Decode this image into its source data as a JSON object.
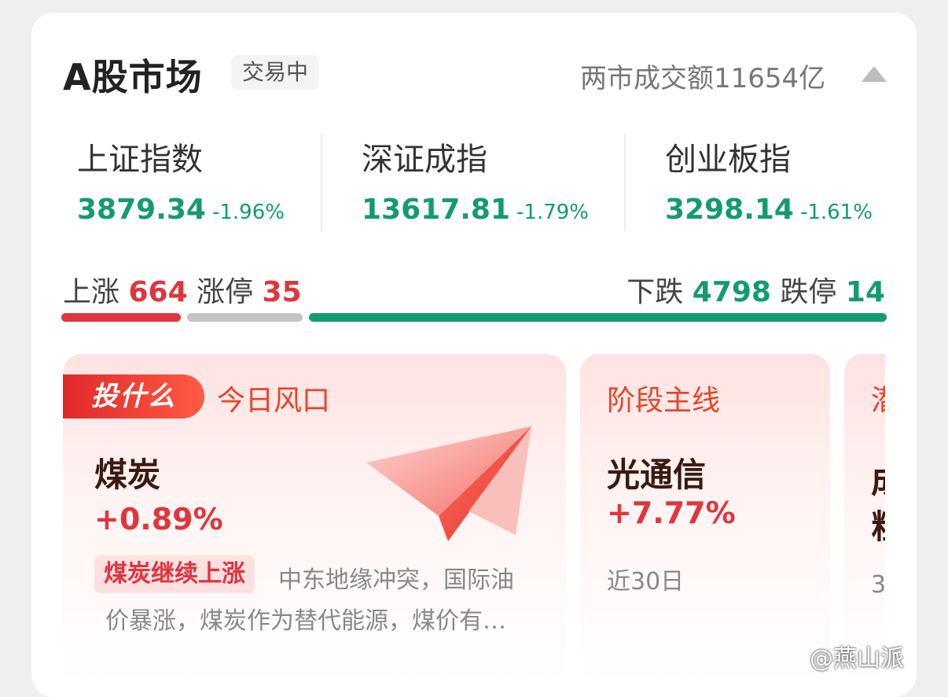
{
  "header": {
    "title": "A股市场",
    "status": "交易中",
    "turnover": "两市成交额11654亿"
  },
  "indices": [
    {
      "name": "上证指数",
      "value": "3879.34",
      "change": "-1.96%"
    },
    {
      "name": "深证成指",
      "value": "13617.81",
      "change": "-1.79%"
    },
    {
      "name": "创业板指",
      "value": "3298.14",
      "change": "-1.61%"
    }
  ],
  "breadth": {
    "up_label": "上涨",
    "up_count": "664",
    "limit_up_label": "涨停",
    "limit_up_count": "35",
    "down_label": "下跌",
    "down_count": "4798",
    "limit_down_label": "跌停",
    "limit_down_count": "14"
  },
  "tiles": {
    "main": {
      "tag": "投什么",
      "heading": "今日风口",
      "sector": "煤炭",
      "change": "+0.89%",
      "chip": "煤炭继续上涨",
      "desc_line1": "中东地缘冲突，国际油",
      "desc_line2": "价暴涨，煤炭作为替代能源，煤价有…"
    },
    "second": {
      "heading": "阶段主线",
      "sector": "光通信",
      "change": "+7.77%",
      "period": "近30日"
    },
    "third": {
      "heading_partial": "潜",
      "line1_partial": "成",
      "line2_partial": "粗",
      "line3_partial": "3"
    }
  },
  "colors": {
    "up_red": "#e0353e",
    "down_green": "#149a71",
    "bar_gray": "#c4c4c4",
    "accent_orange": "#e8432c"
  },
  "watermark": "@燕山派"
}
